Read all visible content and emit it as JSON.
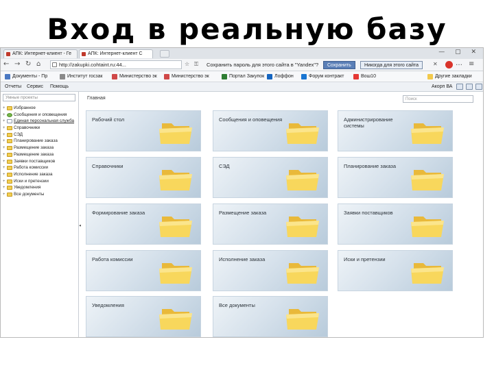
{
  "slide_title": "Вход в реальную базу",
  "browser": {
    "tabs": [
      "АПК: Интернет-клиент - Ге",
      "АПК: Интернет-клиент С"
    ],
    "url": "http://zakupki.cohtaint.ru:44...",
    "password_prompt": "Сохранить пароль для этого сайта в \"Yandex\"?",
    "save_button": "Сохранить",
    "never_button": "Никогда для этого сайта"
  },
  "bookmarks": [
    {
      "label": "Документы - Пр",
      "color": "#4a78c2"
    },
    {
      "label": "Институт госзак",
      "color": "#8a8a8a"
    },
    {
      "label": "Министерство эк",
      "color": "#d04848"
    },
    {
      "label": "Министерство эк",
      "color": "#d04848"
    },
    {
      "label": "Портал Закупок",
      "color": "#2e7d32"
    },
    {
      "label": "Лоффон",
      "color": "#1565c0"
    },
    {
      "label": "Форум контракт",
      "color": "#1976d2"
    },
    {
      "label": "Вош10",
      "color": "#e53935"
    },
    {
      "label": "Другие закладки",
      "color": "#f2c94c"
    }
  ],
  "app_menu": {
    "items": [
      "Отчеты",
      "Сервис",
      "Помощь"
    ],
    "user": "Акорп ВА"
  },
  "sidebar": {
    "search_placeholder": "Умные проекты",
    "items": [
      "Избранное",
      "Сообщения и оповещения",
      "Единая персональная служба",
      "Справочники",
      "СЭД",
      "Планирование заказа",
      "Размещение заказа",
      "Размещение заказа",
      "Заявки поставщиков",
      "Работа комиссии",
      "Исполнение заказа",
      "Иски и претензии",
      "Уведомления",
      "Все документы"
    ]
  },
  "main": {
    "title": "Главная",
    "search_placeholder": "Поиск",
    "tiles": [
      "Рабочий стол",
      "Сообщения и оповещения",
      "Администрирование системы",
      "Справочники",
      "СЭД",
      "Планирование заказа",
      "Формирование заказа",
      "Размещение заказа",
      "Заявки поставщиков",
      "Работа комиссии",
      "Исполнение заказа",
      "Иски и претензии",
      "Уведомления",
      "Все документы"
    ]
  }
}
